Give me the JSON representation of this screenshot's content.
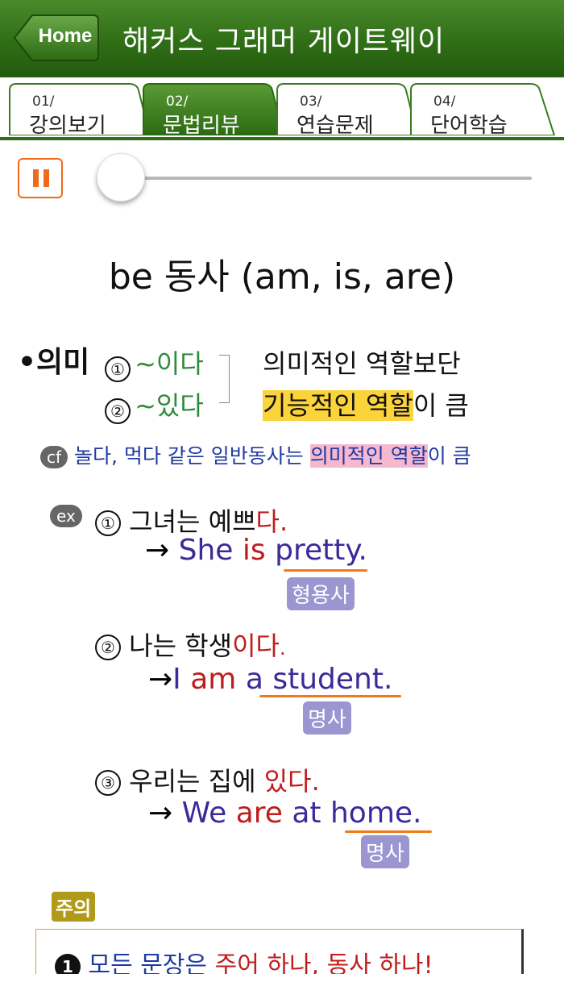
{
  "header": {
    "home_label": "Home",
    "title": "해커스 그래머 게이트웨이"
  },
  "tabs": [
    {
      "num": "01/",
      "label": "강의보기",
      "active": false
    },
    {
      "num": "02/",
      "label": "문법리뷰",
      "active": true
    },
    {
      "num": "03/",
      "label": "연습문제",
      "active": false
    },
    {
      "num": "04/",
      "label": "단어학습",
      "active": false
    }
  ],
  "player": {
    "state": "playing",
    "progress": 0.0
  },
  "lesson": {
    "title": "be 동사 (am, is, are)",
    "meaning_label": "•의미",
    "m1_num": "①",
    "m1_text": "~이다",
    "m2_num": "②",
    "m2_text": "~있다",
    "note_line1": "의미적인 역할보단",
    "note_line2_hl": "기능적인 역할",
    "note_line2_rest": "이 큼",
    "cf_label": "cf",
    "cf_text": "놀다, 먹다 같은 일반동사는 ",
    "cf_hl": "의미적인 역할",
    "cf_rest": "이 큼",
    "ex_label": "ex",
    "examples": [
      {
        "num": "①",
        "kr_pre": "그녀는 예쁘",
        "kr_em": "다.",
        "arrow": "→",
        "en_1": "She ",
        "en_2": "is",
        "en_3": " pretty.",
        "tag": "형용사"
      },
      {
        "num": "②",
        "kr_pre": "나는 학생",
        "kr_em": "이다",
        "kr_end": ".",
        "arrow": "→",
        "en_1": "I ",
        "en_2": "am",
        "en_3": " a student.",
        "tag": "명사"
      },
      {
        "num": "③",
        "kr_pre": "우리는 집에 ",
        "kr_em": "있다",
        "kr_end": ".",
        "arrow": "→",
        "en_1": "We ",
        "en_2": "are",
        "en_3": " at home.",
        "tag": "명사"
      }
    ],
    "caution_label": "주의",
    "rule_num": "1",
    "rule_pre": "모든 문장은 ",
    "rule_em": "주어 하나, 동사 하나!"
  },
  "colors": {
    "header_green": "#2f6e16",
    "accent_orange": "#f06a1c",
    "highlight_yellow": "#fbd33a",
    "highlight_pink": "#f6b8cf"
  }
}
